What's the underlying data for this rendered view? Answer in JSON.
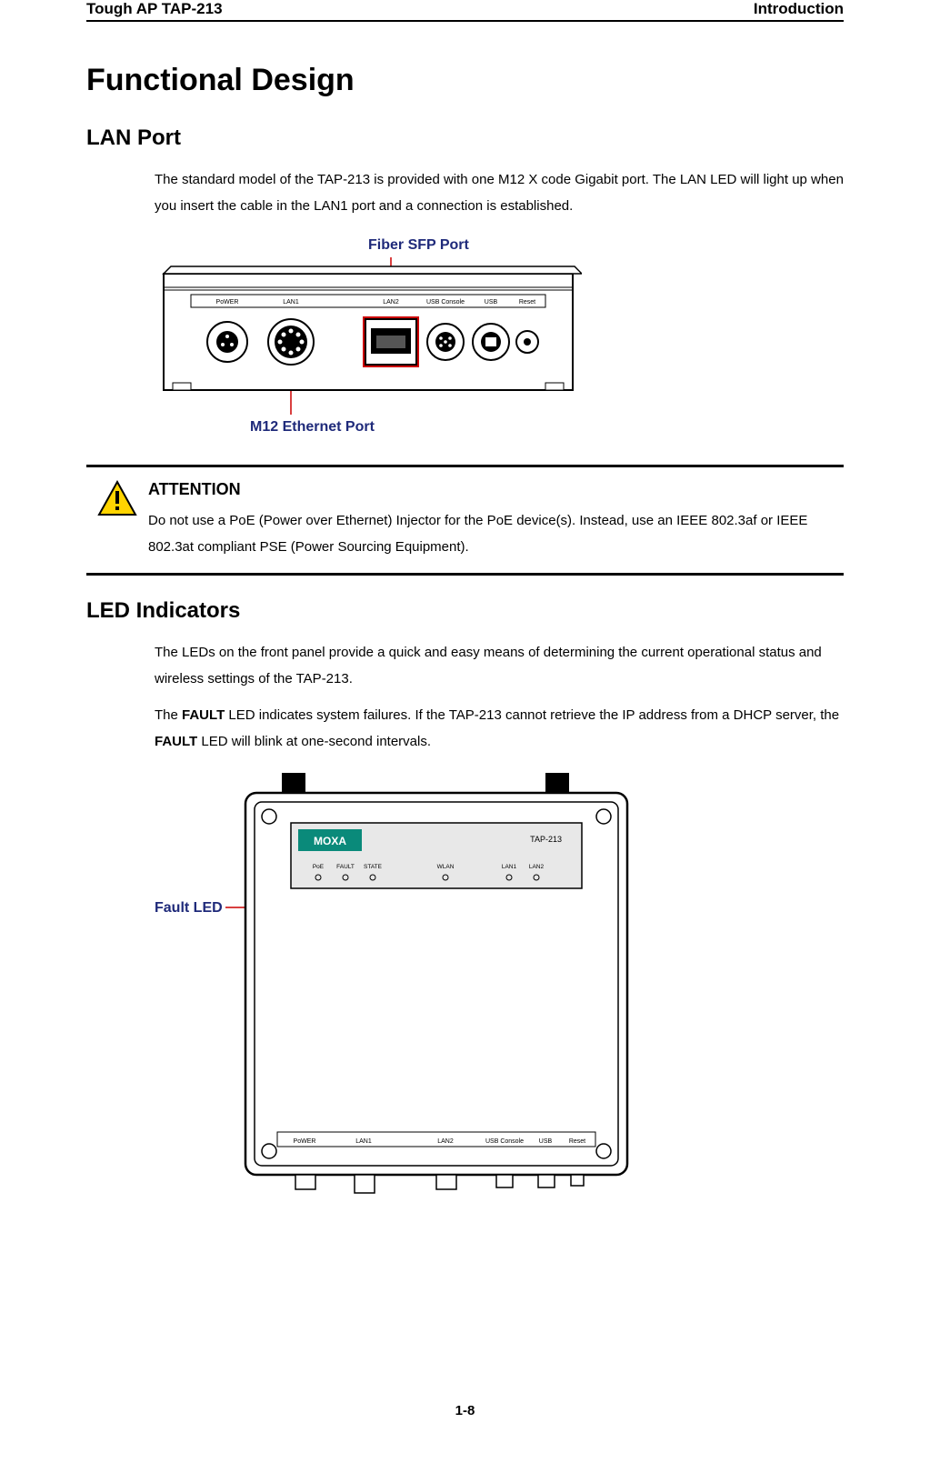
{
  "header": {
    "left": "Tough AP TAP-213",
    "right": "Introduction"
  },
  "main_title": "Functional Design",
  "section_lan": {
    "heading": "LAN Port",
    "para1": "The standard model of the TAP-213 is provided with one M12 X code Gigabit port. The LAN LED will light up when you insert the cable in the LAN1 port and a connection is established."
  },
  "figure1": {
    "top_label": "Fiber SFP Port",
    "bottom_label": "M12 Ethernet Port",
    "port_labels": [
      "PoWER",
      "LAN1",
      "LAN2",
      "USB Console",
      "USB",
      "Reset"
    ]
  },
  "attention": {
    "title": "ATTENTION",
    "body": "Do not use a PoE (Power over Ethernet) Injector for the PoE device(s). Instead, use an IEEE 802.3af or IEEE 802.3at compliant PSE (Power Sourcing Equipment)."
  },
  "section_led": {
    "heading": "LED Indicators",
    "para1": "The LEDs on the front panel provide a quick and easy means of determining the current operational status and wireless settings of the TAP-213.",
    "para2_pre": "The ",
    "fault_word": "FAULT",
    "para2_mid": " LED indicates system failures. If the TAP-213 cannot retrieve the IP address from a DHCP server, the ",
    "para2_post": " LED will blink at one-second intervals."
  },
  "figure2": {
    "side_label": "Fault LED",
    "brand": "MOXA",
    "model": "TAP-213",
    "led_row": [
      "PoE",
      "FAULT",
      "STATE",
      "WLAN",
      "LAN1",
      "LAN2"
    ],
    "bottom_row": [
      "PoWER",
      "LAN1",
      "LAN2",
      "USB Console",
      "USB",
      "Reset"
    ]
  },
  "page_number": "1-8"
}
